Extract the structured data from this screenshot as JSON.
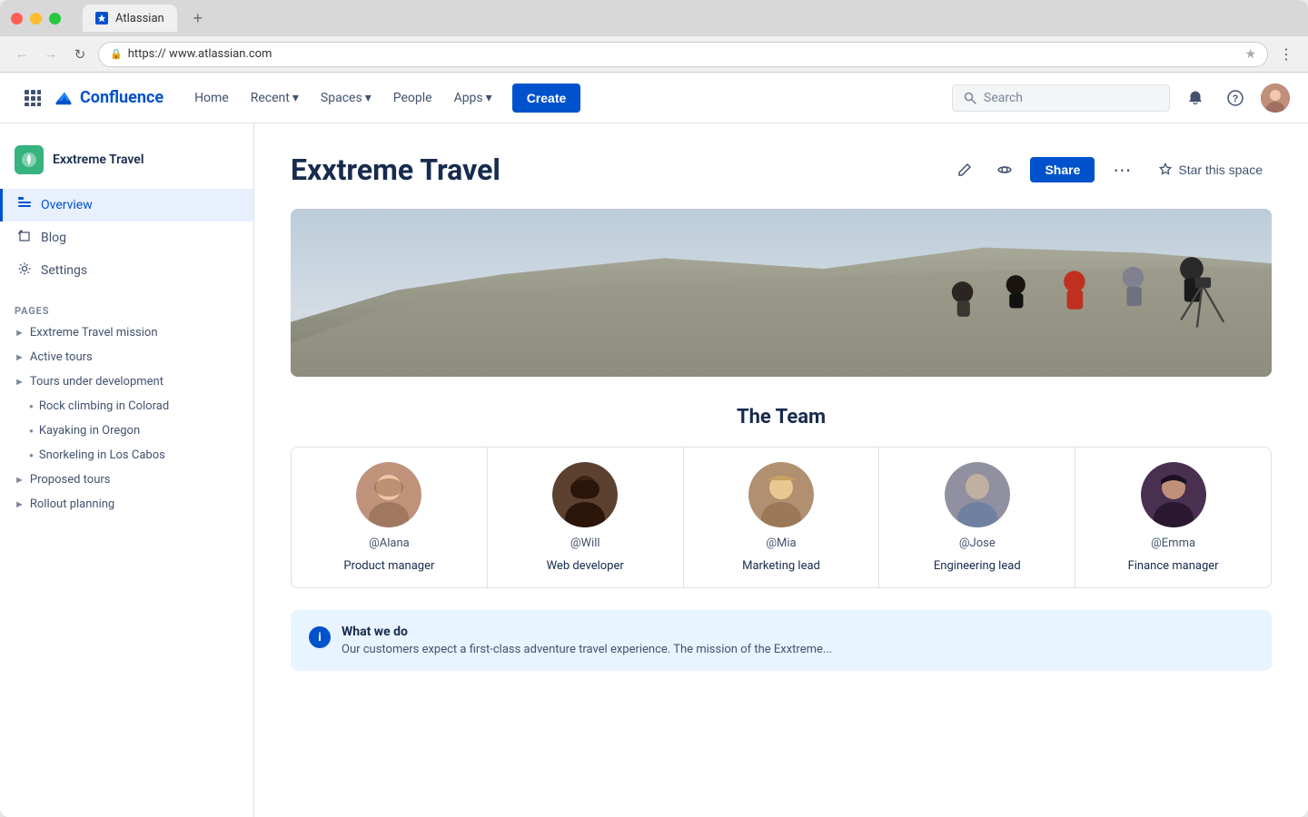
{
  "browser": {
    "url": "https:// www.atlassian.com",
    "tab_title": "Atlassian",
    "new_tab_label": "+"
  },
  "nav": {
    "logo_text": "Confluence",
    "home_label": "Home",
    "recent_label": "Recent",
    "spaces_label": "Spaces",
    "people_label": "People",
    "apps_label": "Apps",
    "create_label": "Create",
    "search_placeholder": "Search"
  },
  "sidebar": {
    "space_name": "Exxtreme Travel",
    "overview_label": "Overview",
    "blog_label": "Blog",
    "settings_label": "Settings",
    "pages_section_label": "PAGES",
    "pages": [
      {
        "label": "Exxtreme Travel mission",
        "indent": 0
      },
      {
        "label": "Active tours",
        "indent": 0
      },
      {
        "label": "Tours under development",
        "indent": 0
      },
      {
        "label": "Rock climbing in Colorad",
        "indent": 1,
        "bullet": true
      },
      {
        "label": "Kayaking in Oregon",
        "indent": 1,
        "bullet": true
      },
      {
        "label": "Snorkeling in Los Cabos",
        "indent": 1,
        "bullet": true
      },
      {
        "label": "Proposed tours",
        "indent": 0
      },
      {
        "label": "Rollout planning",
        "indent": 0
      }
    ]
  },
  "page": {
    "title": "Exxtreme Travel",
    "share_label": "Share",
    "star_space_label": "Star this space",
    "team_section_title": "The Team",
    "team_members": [
      {
        "handle": "@Alana",
        "role": "Product manager",
        "avatar_color": "#c4a882"
      },
      {
        "handle": "@Will",
        "role": "Web developer",
        "avatar_color": "#3d2b1a"
      },
      {
        "handle": "@Mia",
        "role": "Marketing lead",
        "avatar_color": "#c8a870"
      },
      {
        "handle": "@Jose",
        "role": "Engineering lead",
        "avatar_color": "#c0c0c0"
      },
      {
        "handle": "@Emma",
        "role": "Finance manager",
        "avatar_color": "#2a1a2a"
      }
    ],
    "info_box": {
      "title": "What we do",
      "text": "Our customers expect a first-class adventure travel experience. The mission of the Exxtreme..."
    }
  }
}
